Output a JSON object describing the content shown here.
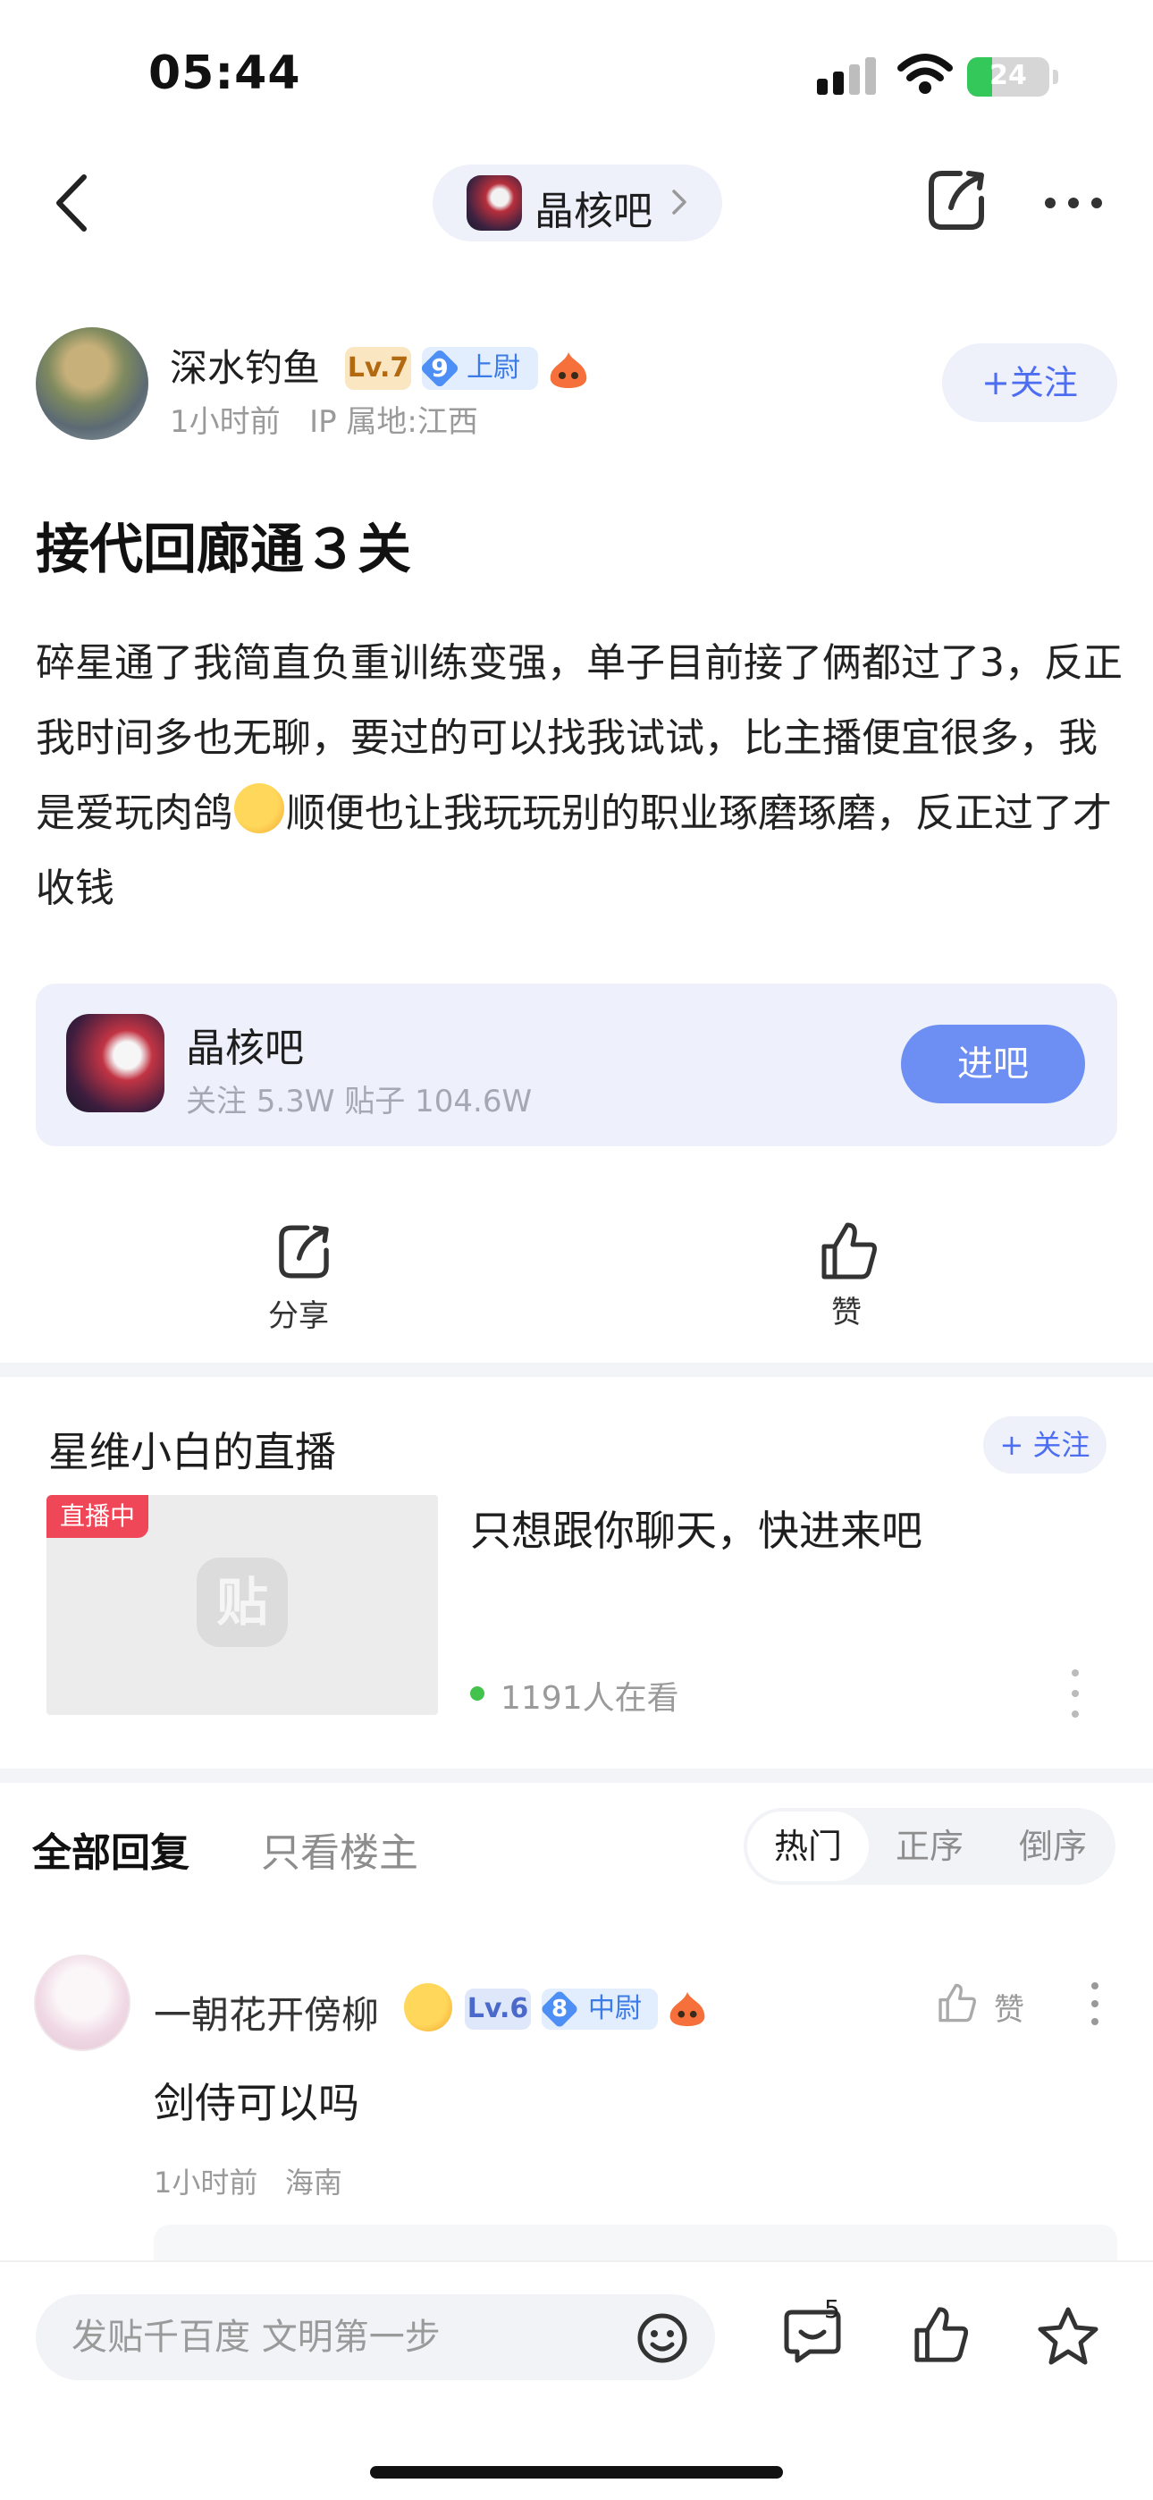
{
  "status_bar": {
    "time": "05:44",
    "battery": "24"
  },
  "nav": {
    "forum_name": "晶核吧"
  },
  "author": {
    "name": "深水钓鱼",
    "level": "Lv.7",
    "rank_num": "9",
    "rank_title": "上尉",
    "time": "1小时前",
    "location": "IP 属地:江西",
    "follow_label": "+关注"
  },
  "post": {
    "title": "接代回廊通３关",
    "body_part1": "碎星通了我简直负重训练变强，单子目前接了俩都过了3，反正我时间多也无聊，要过的可以找我试试，比主播便宜很多，我是爱玩肉鸽",
    "body_part2": "顺便也让我玩玩别的职业琢磨琢磨，反正过了才收钱"
  },
  "forum_card": {
    "name": "晶核吧",
    "stats": "关注 5.3W   贴子 104.6W",
    "enter_label": "进吧"
  },
  "actions": {
    "share_label": "分享",
    "like_label": "赞"
  },
  "live": {
    "title": "星维小白的直播",
    "follow_label": "+ 关注",
    "badge": "直播中",
    "thumb_logo": "贴",
    "text": "只想跟你聊天，快进来吧",
    "viewers": "1191人在看"
  },
  "replies": {
    "tab_all": "全部回复",
    "tab_owner": "只看楼主",
    "sort": {
      "hot": "热门",
      "asc": "正序",
      "desc": "倒序"
    }
  },
  "comment": {
    "name": "一朝花开傍柳",
    "level": "Lv.6",
    "rank_num": "8",
    "rank_title": "中尉",
    "like_label": "赞",
    "text": "剑侍可以吗",
    "time": "1小时前",
    "location": "海南"
  },
  "bottom_bar": {
    "placeholder": "发贴千百度 文明第一步",
    "comment_count": "5"
  },
  "colors": {
    "accent": "#4e6ef2",
    "enter_button": "#6d8ef3",
    "live_badge": "#f04758",
    "live_dot": "#43c24c",
    "battery_green": "#34c759"
  },
  "icons": [
    "back-chevron-icon",
    "share-icon",
    "more-icon",
    "fire-icon",
    "like-icon",
    "emoji-icon",
    "comment-icon",
    "star-icon",
    "wifi-icon",
    "signal-icon"
  ]
}
